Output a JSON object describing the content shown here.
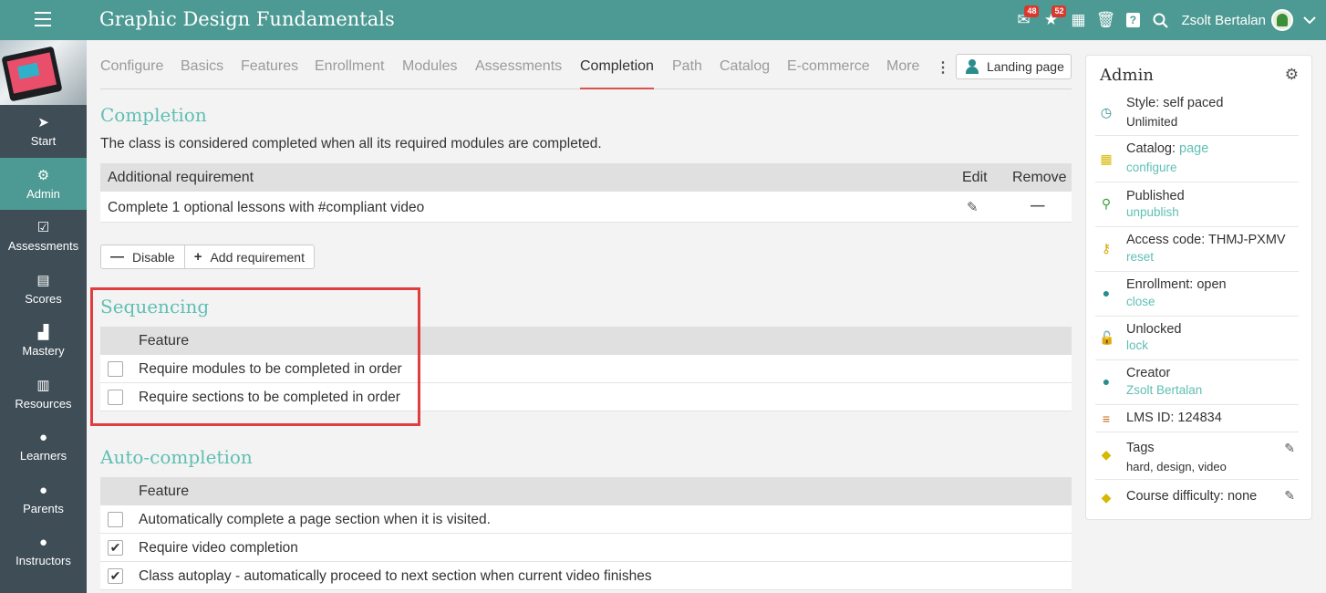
{
  "app": {
    "title": "Graphic Design Fundamentals"
  },
  "topbar": {
    "mail_badge": "48",
    "notif_badge": "52",
    "user_name": "Zsolt Bertalan"
  },
  "sidebar": {
    "items": [
      {
        "label": "Start",
        "icon": "navigate-icon"
      },
      {
        "label": "Admin",
        "icon": "gear-icon"
      },
      {
        "label": "Assessments",
        "icon": "check-icon"
      },
      {
        "label": "Scores",
        "icon": "table-icon"
      },
      {
        "label": "Mastery",
        "icon": "bar-chart-icon"
      },
      {
        "label": "Resources",
        "icon": "books-icon"
      },
      {
        "label": "Learners",
        "icon": "person-icon"
      },
      {
        "label": "Parents",
        "icon": "person-icon"
      },
      {
        "label": "Instructors",
        "icon": "person-icon"
      }
    ]
  },
  "tabs": [
    "Configure",
    "Basics",
    "Features",
    "Enrollment",
    "Modules",
    "Assessments",
    "Completion",
    "Path",
    "Catalog",
    "E-commerce",
    "More"
  ],
  "landing_page_label": "Landing page",
  "completion": {
    "title": "Completion",
    "description": "The class is considered completed when all its required modules are completed.",
    "columns": {
      "requirement": "Additional requirement",
      "edit": "Edit",
      "remove": "Remove"
    },
    "rows": [
      {
        "requirement": "Complete 1 optional lessons with #compliant video"
      }
    ],
    "disable_label": "Disable",
    "add_label": "Add requirement"
  },
  "sequencing": {
    "title": "Sequencing",
    "column": "Feature",
    "rows": [
      {
        "label": "Require modules to be completed in order",
        "checked": false
      },
      {
        "label": "Require sections to be completed in order",
        "checked": false
      }
    ]
  },
  "autocompletion": {
    "title": "Auto-completion",
    "column": "Feature",
    "rows": [
      {
        "label": "Automatically complete a page section when it is visited.",
        "checked": false
      },
      {
        "label": "Require video completion",
        "checked": true
      },
      {
        "label": "Class autoplay - automatically proceed to next section when current video finishes",
        "checked": true
      }
    ]
  },
  "admin": {
    "title": "Admin",
    "style_label": "Style: self paced",
    "style_sub": "Unlimited",
    "catalog_label": "Catalog:",
    "catalog_link": "page",
    "catalog_sub": "configure",
    "published_label": "Published",
    "published_sub": "unpublish",
    "access_label": "Access code: THMJ-PXMV",
    "access_sub": "reset",
    "enrollment_label": "Enrollment: open",
    "enrollment_sub": "close",
    "unlocked_label": "Unlocked",
    "unlocked_sub": "lock",
    "creator_label": "Creator",
    "creator_sub": "Zsolt Bertalan",
    "lms_label": "LMS ID: 124834",
    "tags_label": "Tags",
    "tags_sub": "hard, design, video",
    "difficulty_label": "Course difficulty: none"
  },
  "colors": {
    "topbar": "#4c9a93",
    "sidebar": "#3e4d56",
    "accent": "#5fbfb4",
    "highlight": "#e03e3e"
  }
}
